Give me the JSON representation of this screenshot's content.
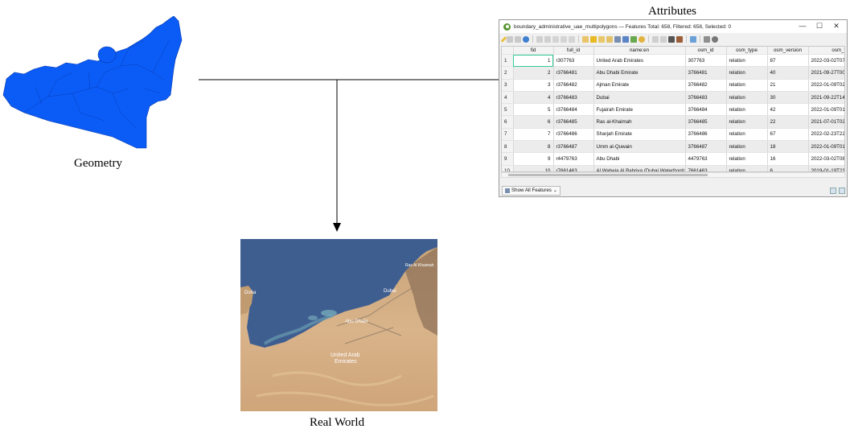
{
  "captions": {
    "attributes": "Attributes",
    "geometry": "Geometry",
    "real_world": "Real World"
  },
  "colors": {
    "polygon_fill": "#0b5cf7",
    "polygon_stroke": "#0636a6",
    "sea": "#3f5e90",
    "desert": "#d8b48a"
  },
  "window": {
    "title": "boundary_administrative_uae_multipolygons — Features Total: 658, Filtered: 658, Selected: 0",
    "controls": [
      "—",
      "☐",
      "✕"
    ],
    "show_all_label": "Show All Features",
    "columns": [
      "fid",
      "full_id",
      "name:en",
      "osm_id",
      "osm_type",
      "osm_version",
      "osm_timestam"
    ],
    "rows": [
      {
        "n": "1",
        "fid": "1",
        "full_id": "r307763",
        "name": "United Arab Emirates",
        "osm_id": "307763",
        "osm_type": "relation",
        "osm_version": "87",
        "ts": "2022-03-02T07:"
      },
      {
        "n": "2",
        "fid": "2",
        "full_id": "r3766481",
        "name": "Abu Dhabi Emirate",
        "osm_id": "3766481",
        "osm_type": "relation",
        "osm_version": "40",
        "ts": "2021-09-27T00:"
      },
      {
        "n": "3",
        "fid": "3",
        "full_id": "r3766482",
        "name": "Ajman Emirate",
        "osm_id": "3766482",
        "osm_type": "relation",
        "osm_version": "21",
        "ts": "2022-01-09T02:"
      },
      {
        "n": "4",
        "fid": "4",
        "full_id": "r3766483",
        "name": "Dubai",
        "osm_id": "3766483",
        "osm_type": "relation",
        "osm_version": "30",
        "ts": "2021-09-22T14:"
      },
      {
        "n": "5",
        "fid": "5",
        "full_id": "r3766484",
        "name": "Fujairah Emirate",
        "osm_id": "3766484",
        "osm_type": "relation",
        "osm_version": "42",
        "ts": "2022-01-09T01:"
      },
      {
        "n": "6",
        "fid": "6",
        "full_id": "r3766485",
        "name": "Ras al-Khaimah",
        "osm_id": "3766485",
        "osm_type": "relation",
        "osm_version": "22",
        "ts": "2021-07-01T02:"
      },
      {
        "n": "7",
        "fid": "7",
        "full_id": "r3766486",
        "name": "Sharjah Emirate",
        "osm_id": "3766486",
        "osm_type": "relation",
        "osm_version": "67",
        "ts": "2022-02-23T22:"
      },
      {
        "n": "8",
        "fid": "8",
        "full_id": "r3766487",
        "name": "Umm al-Quwain",
        "osm_id": "3766487",
        "osm_type": "relation",
        "osm_version": "18",
        "ts": "2022-01-09T01:"
      },
      {
        "n": "9",
        "fid": "9",
        "full_id": "r4479763",
        "name": "Abu Dhabi",
        "osm_id": "4479763",
        "osm_type": "relation",
        "osm_version": "16",
        "ts": "2022-03-02T08:"
      },
      {
        "n": "10",
        "fid": "10",
        "full_id": "r7661463",
        "name": "Al Waheja Al Bahriya (Dubai Waterfront)",
        "osm_id": "7661463",
        "osm_type": "relation",
        "osm_version": "6",
        "ts": "2019-01-19T23:"
      }
    ]
  },
  "photo_labels": {
    "doha": "Doha",
    "dubai": "Dubai",
    "abu_dhabi": "Abu Dhabi",
    "uae_line1": "United Arab",
    "uae_line2": "Emirates",
    "ras": "Ras Al Khaimah"
  }
}
